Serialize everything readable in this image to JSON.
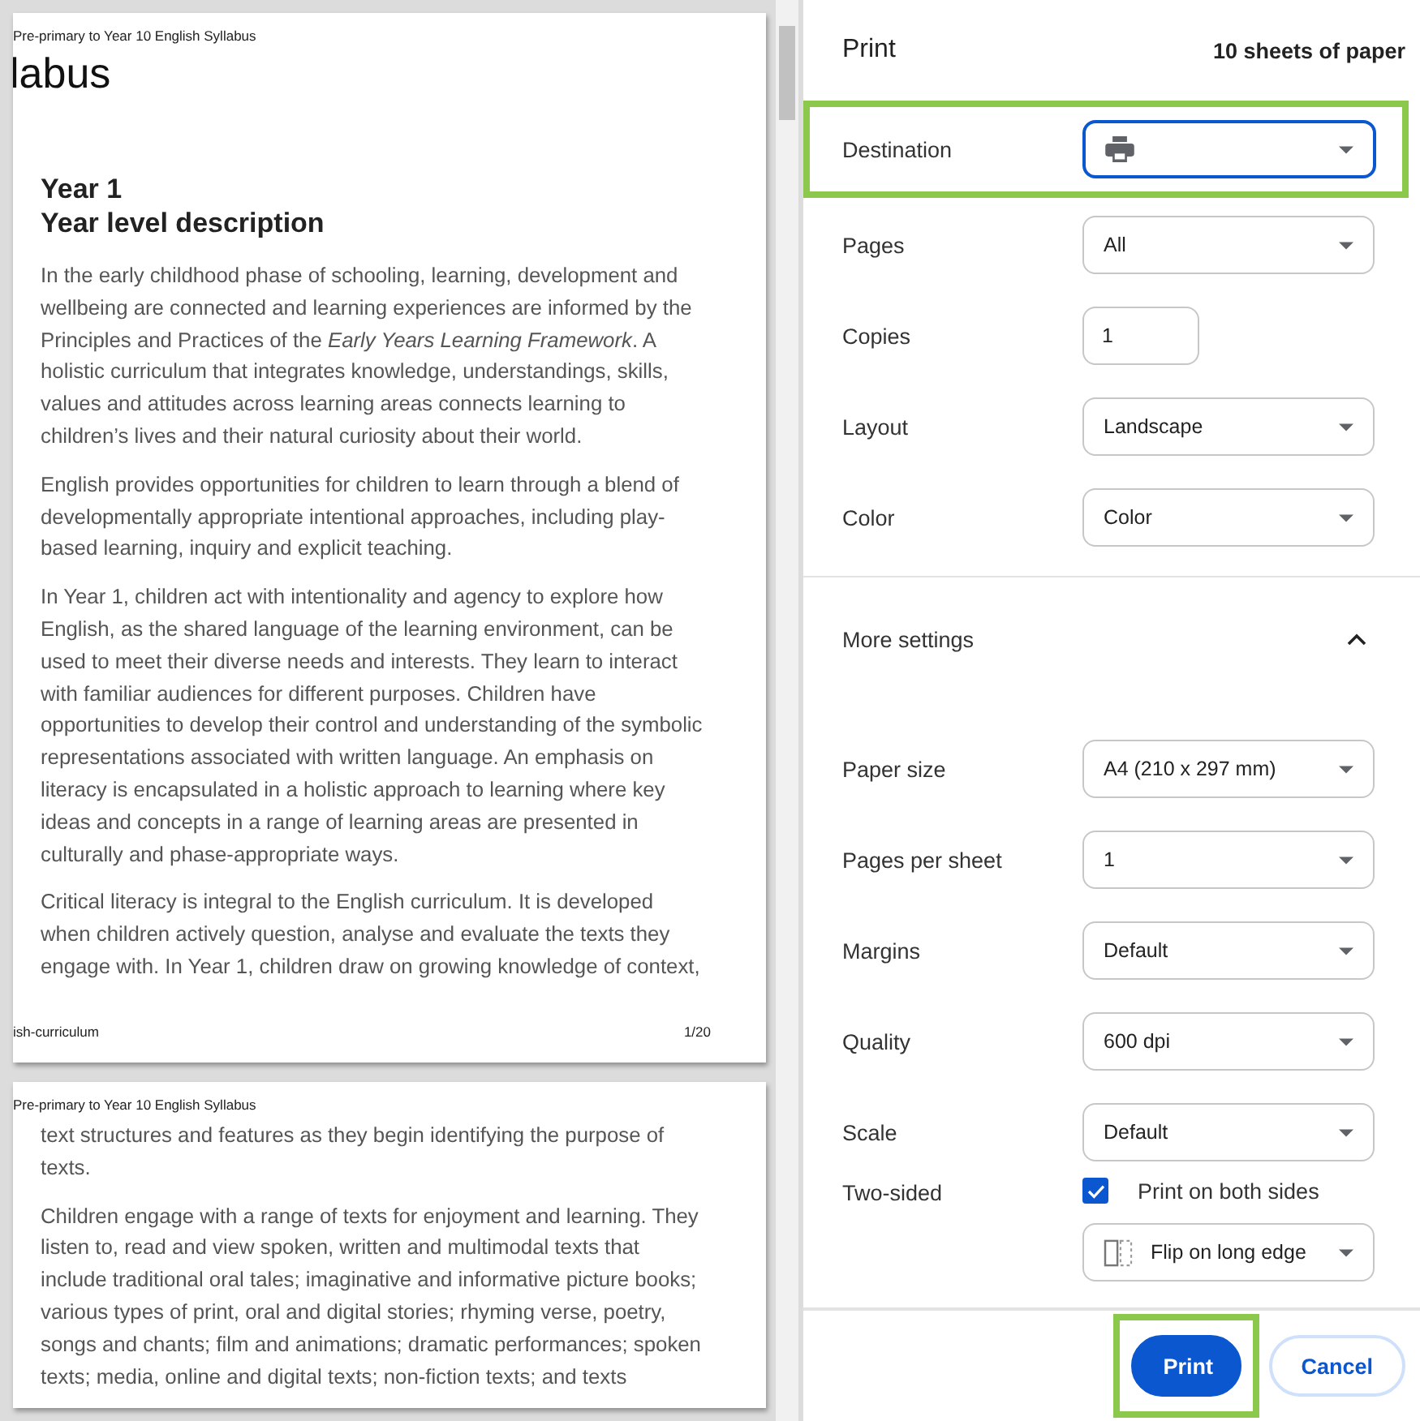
{
  "preview": {
    "pages": [
      {
        "header": "Pre-primary to Year 10 English Syllabus",
        "title": "labus",
        "heading": [
          "Year 1",
          "Year level description"
        ],
        "paragraphs": [
          "In the early childhood phase of schooling, learning, development and wellbeing are connected and learning experiences are informed by the Principles and Practices of the *Early Years Learning Framework*. A holistic curriculum that integrates knowledge, understandings, skills, values and attitudes across learning areas connects learning to children’s lives and their natural curiosity about their world.",
          "English provides opportunities for children to learn through a blend of developmentally appropriate intentional approaches, including play-based learning, inquiry and explicit teaching.",
          "In Year 1, children act with intentionality and agency to explore how English, as the shared language of the learning environment, can be used to meet their diverse needs and interests. They learn to interact with familiar audiences for different purposes. Children have opportunities to develop their control and understanding of the symbolic representations associated with written language. An emphasis on literacy is encapsulated in a holistic approach to learning where key ideas and concepts in a range of learning areas are presented in culturally and phase-appropriate ways.",
          "Critical literacy is integral to the English curriculum. It is developed when children actively question, analyse and evaluate the texts they engage with. In Year 1, children draw on growing knowledge of context,"
        ],
        "footer_left": "ish-curriculum",
        "footer_right": "1/20"
      },
      {
        "header": "Pre-primary to Year 10 English Syllabus",
        "paragraphs": [
          "text structures and features as they begin identifying the purpose of texts.",
          "Children engage with a range of texts for enjoyment and learning. They listen to, read and view spoken, written and multimodal texts that include traditional oral tales; imaginative and informative picture books; various types of print, oral and digital stories; rhyming verse, poetry, songs and chants; film and animations; dramatic performances; spoken texts; media, online and digital texts; non-fiction texts; and texts"
        ]
      }
    ]
  },
  "panel": {
    "title": "Print",
    "sheets": "10 sheets of paper",
    "settings": [
      {
        "kind": "printer",
        "label": "Destination",
        "highlighted": true
      },
      {
        "kind": "select",
        "label": "Pages",
        "value": "All"
      },
      {
        "kind": "number",
        "label": "Copies",
        "value": "1"
      },
      {
        "kind": "select",
        "label": "Layout",
        "value": "Landscape"
      },
      {
        "kind": "select",
        "label": "Color",
        "value": "Color"
      }
    ],
    "more_settings": {
      "label": "More settings",
      "expanded": true,
      "settings": [
        {
          "kind": "select",
          "label": "Paper size",
          "value": "A4 (210 x 297 mm)"
        },
        {
          "kind": "select",
          "label": "Pages per sheet",
          "value": "1"
        },
        {
          "kind": "select",
          "label": "Margins",
          "value": "Default"
        },
        {
          "kind": "select",
          "label": "Quality",
          "value": "600 dpi"
        },
        {
          "kind": "select",
          "label": "Scale",
          "value": "Default"
        },
        {
          "kind": "duplex",
          "label": "Two-sided",
          "checked": true,
          "option": "Print on both sides",
          "value": "Flip on long edge"
        }
      ]
    },
    "buttons": [
      {
        "label": "Print",
        "primary": true,
        "highlighted": true
      },
      {
        "label": "Cancel",
        "primary": false,
        "highlighted": false
      }
    ]
  }
}
